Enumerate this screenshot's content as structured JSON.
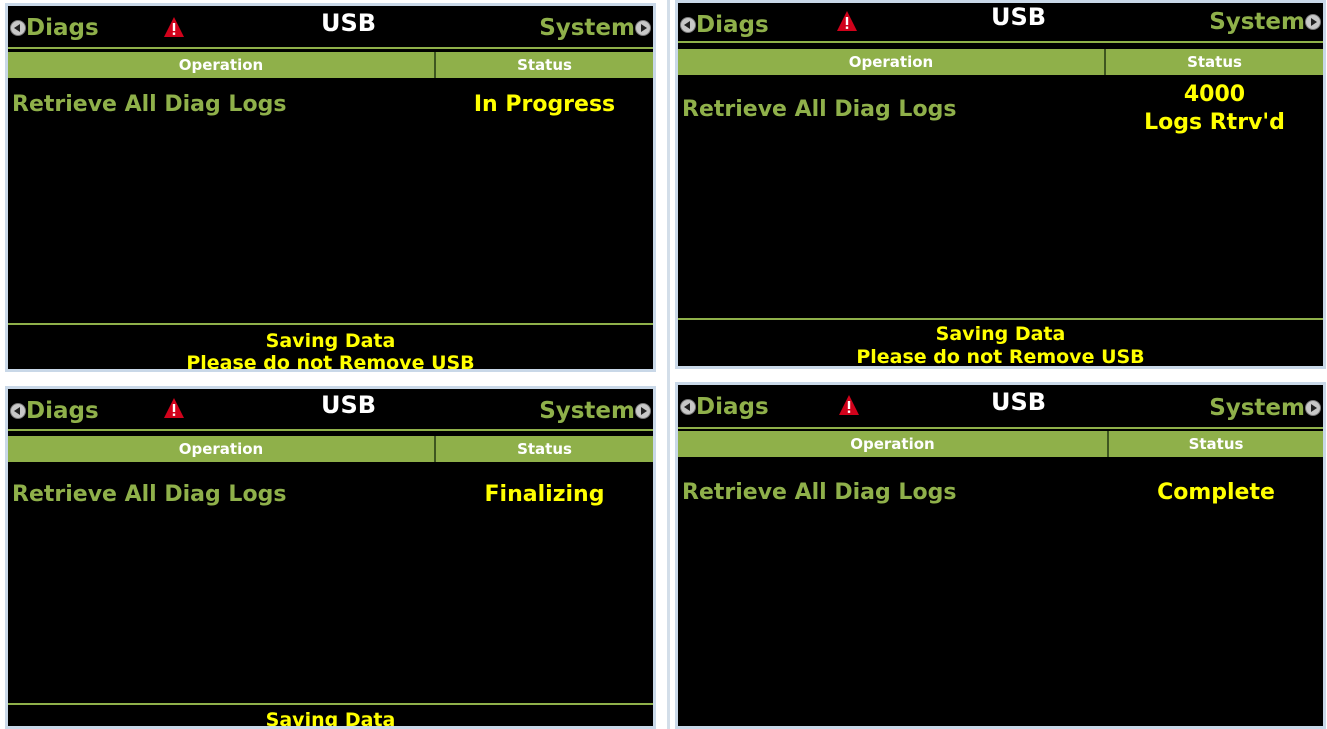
{
  "screens": [
    {
      "nav_left": "Diags",
      "title": "USB",
      "nav_right": "System",
      "header_operation": "Operation",
      "header_status": "Status",
      "operation": "Retrieve All Diag Logs",
      "status_line1": "In Progress",
      "status_line2": "",
      "footer_line1": "Saving Data",
      "footer_line2": "Please do not Remove USB"
    },
    {
      "nav_left": "Diags",
      "title": "USB",
      "nav_right": "System",
      "header_operation": "Operation",
      "header_status": "Status",
      "operation": "Retrieve All Diag Logs",
      "status_line1": "4000",
      "status_line2": "Logs Rtrv'd",
      "footer_line1": "Saving Data",
      "footer_line2": "Please do not Remove USB"
    },
    {
      "nav_left": "Diags",
      "title": "USB",
      "nav_right": "System",
      "header_operation": "Operation",
      "header_status": "Status",
      "operation": "Retrieve All Diag Logs",
      "status_line1": "Finalizing",
      "status_line2": "",
      "footer_line1": "Saving Data",
      "footer_line2": ""
    },
    {
      "nav_left": "Diags",
      "title": "USB",
      "nav_right": "System",
      "header_operation": "Operation",
      "header_status": "Status",
      "operation": "Retrieve All Diag Logs",
      "status_line1": "Complete",
      "status_line2": "",
      "footer_line1": "",
      "footer_line2": ""
    }
  ],
  "colors": {
    "screen_bg": "#000000",
    "accent_green": "#8fb04a",
    "status_yellow": "#ffff00",
    "alert_red": "#d0021b"
  },
  "icons": {
    "nav_left": "chevron-left-circle-icon",
    "alert": "alert-triangle-icon",
    "nav_right": "chevron-right-circle-icon"
  }
}
